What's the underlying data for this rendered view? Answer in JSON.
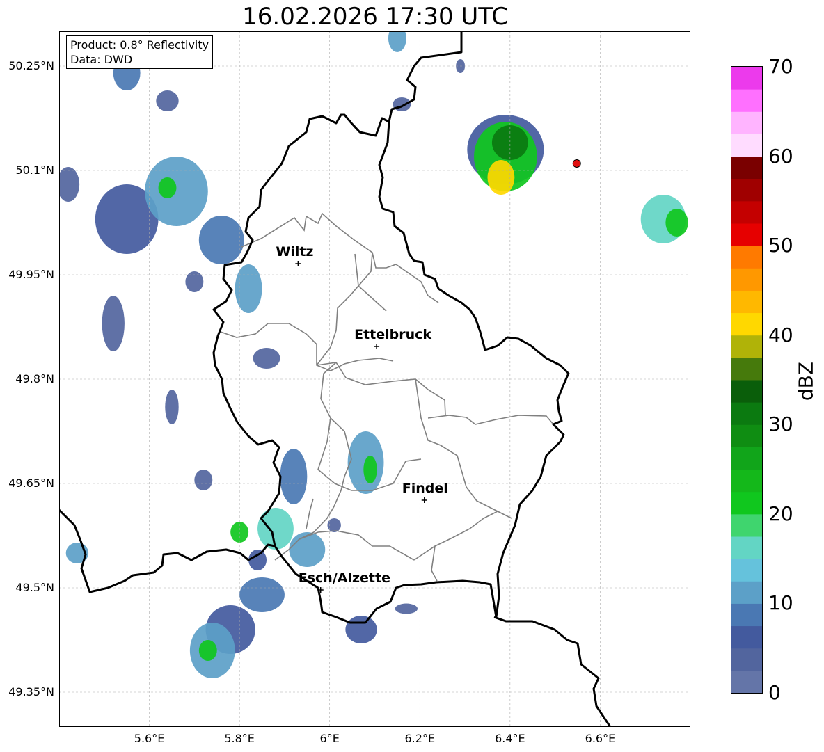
{
  "title": "16.02.2026 17:30 UTC",
  "info": {
    "product": "Product: 0.8° Reflectivity",
    "data": "Data: DWD"
  },
  "axes": {
    "lon_range": [
      5.4,
      6.8
    ],
    "lat_range": [
      49.3,
      50.3
    ],
    "lon_ticks": [
      {
        "value": 5.6,
        "label": "5.6°E"
      },
      {
        "value": 5.8,
        "label": "5.8°E"
      },
      {
        "value": 6.0,
        "label": "6°E"
      },
      {
        "value": 6.2,
        "label": "6.2°E"
      },
      {
        "value": 6.4,
        "label": "6.4°E"
      },
      {
        "value": 6.6,
        "label": "6.6°E"
      }
    ],
    "lat_ticks": [
      {
        "value": 50.25,
        "label": "50.25°N"
      },
      {
        "value": 50.1,
        "label": "50.1°N"
      },
      {
        "value": 49.95,
        "label": "49.95°N"
      },
      {
        "value": 49.8,
        "label": "49.8°N"
      },
      {
        "value": 49.65,
        "label": "49.65°N"
      },
      {
        "value": 49.5,
        "label": "49.5°N"
      },
      {
        "value": 49.35,
        "label": "49.35°N"
      }
    ]
  },
  "cities": [
    {
      "name": "Wiltz",
      "lon": 5.93,
      "lat": 49.966
    },
    {
      "name": "Ettelbruck",
      "lon": 6.104,
      "lat": 49.847
    },
    {
      "name": "Findel",
      "lon": 6.21,
      "lat": 49.626
    },
    {
      "name": "Esch/Alzette",
      "lon": 5.98,
      "lat": 49.497
    }
  ],
  "radar_site": {
    "lon": 6.548,
    "lat": 50.11,
    "color": "#e01010"
  },
  "colorbar": {
    "label": "dBZ",
    "min": 0,
    "max": 70,
    "step": 2.5,
    "tick_labels": [
      "0",
      "10",
      "20",
      "30",
      "40",
      "50",
      "60",
      "70"
    ],
    "colors": [
      "#6475a8",
      "#52659e",
      "#435a9e",
      "#4a78b3",
      "#5ca0c8",
      "#65c2dc",
      "#63d5c4",
      "#3fd56e",
      "#10c71e",
      "#14b81a",
      "#11a51a",
      "#0f8d12",
      "#0b7a10",
      "#0a5e0a",
      "#467a0c",
      "#b0b308",
      "#ffd800",
      "#ffb800",
      "#ff9800",
      "#ff7a00",
      "#e60000",
      "#c40000",
      "#a00000",
      "#7a0000",
      "#ffdcff",
      "#ffb4ff",
      "#ff70ff",
      "#ec3aec"
    ]
  },
  "echoes": [
    {
      "lon": 5.55,
      "lat": 50.24,
      "w": 0.06,
      "h": 0.05,
      "dbz": 8
    },
    {
      "lon": 5.64,
      "lat": 50.2,
      "w": 0.05,
      "h": 0.03,
      "dbz": 4
    },
    {
      "lon": 5.42,
      "lat": 50.08,
      "w": 0.05,
      "h": 0.05,
      "dbz": 4
    },
    {
      "lon": 5.55,
      "lat": 50.03,
      "w": 0.14,
      "h": 0.1,
      "dbz": 6
    },
    {
      "lon": 5.66,
      "lat": 50.07,
      "w": 0.14,
      "h": 0.1,
      "dbz": 12
    },
    {
      "lon": 5.64,
      "lat": 50.075,
      "w": 0.04,
      "h": 0.03,
      "dbz": 22
    },
    {
      "lon": 5.76,
      "lat": 50.0,
      "w": 0.1,
      "h": 0.07,
      "dbz": 8
    },
    {
      "lon": 5.82,
      "lat": 49.93,
      "w": 0.06,
      "h": 0.07,
      "dbz": 10
    },
    {
      "lon": 5.52,
      "lat": 49.88,
      "w": 0.05,
      "h": 0.08,
      "dbz": 4
    },
    {
      "lon": 5.7,
      "lat": 49.94,
      "w": 0.04,
      "h": 0.03,
      "dbz": 4
    },
    {
      "lon": 5.86,
      "lat": 49.83,
      "w": 0.06,
      "h": 0.03,
      "dbz": 4
    },
    {
      "lon": 5.65,
      "lat": 49.76,
      "w": 0.03,
      "h": 0.05,
      "dbz": 4
    },
    {
      "lon": 5.72,
      "lat": 49.655,
      "w": 0.04,
      "h": 0.03,
      "dbz": 4
    },
    {
      "lon": 5.44,
      "lat": 49.55,
      "w": 0.05,
      "h": 0.03,
      "dbz": 10
    },
    {
      "lon": 5.92,
      "lat": 49.66,
      "w": 0.06,
      "h": 0.08,
      "dbz": 8
    },
    {
      "lon": 5.8,
      "lat": 49.58,
      "w": 0.04,
      "h": 0.03,
      "dbz": 20
    },
    {
      "lon": 5.88,
      "lat": 49.585,
      "w": 0.08,
      "h": 0.06,
      "dbz": 15
    },
    {
      "lon": 5.95,
      "lat": 49.555,
      "w": 0.08,
      "h": 0.05,
      "dbz": 10
    },
    {
      "lon": 5.84,
      "lat": 49.54,
      "w": 0.04,
      "h": 0.03,
      "dbz": 6
    },
    {
      "lon": 5.85,
      "lat": 49.49,
      "w": 0.1,
      "h": 0.05,
      "dbz": 8
    },
    {
      "lon": 5.78,
      "lat": 49.44,
      "w": 0.11,
      "h": 0.07,
      "dbz": 6
    },
    {
      "lon": 5.74,
      "lat": 49.41,
      "w": 0.1,
      "h": 0.08,
      "dbz": 12
    },
    {
      "lon": 5.73,
      "lat": 49.41,
      "w": 0.04,
      "h": 0.03,
      "dbz": 22
    },
    {
      "lon": 6.08,
      "lat": 49.68,
      "w": 0.08,
      "h": 0.09,
      "dbz": 10
    },
    {
      "lon": 6.09,
      "lat": 49.67,
      "w": 0.03,
      "h": 0.04,
      "dbz": 20
    },
    {
      "lon": 6.07,
      "lat": 49.44,
      "w": 0.07,
      "h": 0.04,
      "dbz": 6
    },
    {
      "lon": 6.17,
      "lat": 49.47,
      "w": 0.05,
      "h": 0.015,
      "dbz": 4
    },
    {
      "lon": 6.01,
      "lat": 49.59,
      "w": 0.03,
      "h": 0.02,
      "dbz": 4
    },
    {
      "lon": 6.15,
      "lat": 50.29,
      "w": 0.04,
      "h": 0.04,
      "dbz": 10
    },
    {
      "lon": 6.16,
      "lat": 50.195,
      "w": 0.04,
      "h": 0.02,
      "dbz": 4
    },
    {
      "lon": 6.29,
      "lat": 50.25,
      "w": 0.02,
      "h": 0.02,
      "dbz": 4
    },
    {
      "lon": 6.39,
      "lat": 50.13,
      "w": 0.17,
      "h": 0.1,
      "dbz": 6
    },
    {
      "lon": 6.39,
      "lat": 50.12,
      "w": 0.14,
      "h": 0.1,
      "dbz": 22
    },
    {
      "lon": 6.4,
      "lat": 50.14,
      "w": 0.08,
      "h": 0.05,
      "dbz": 30
    },
    {
      "lon": 6.38,
      "lat": 50.09,
      "w": 0.06,
      "h": 0.05,
      "dbz": 40
    },
    {
      "lon": 6.74,
      "lat": 50.03,
      "w": 0.1,
      "h": 0.07,
      "dbz": 15
    },
    {
      "lon": 6.77,
      "lat": 50.025,
      "w": 0.05,
      "h": 0.04,
      "dbz": 22
    }
  ]
}
